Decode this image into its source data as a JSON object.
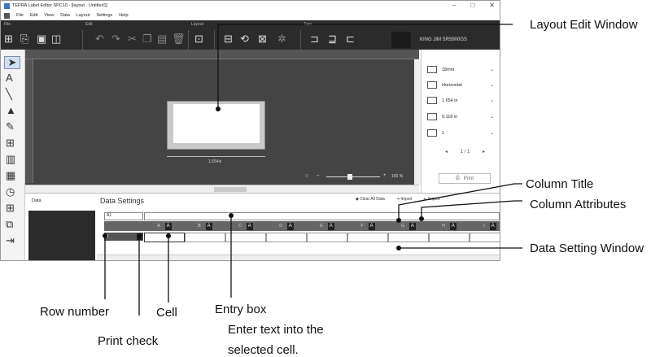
{
  "window": {
    "title": "TEPRA Label Editor SPC10 - [layout - Untitled1]",
    "controls": [
      "–",
      "□",
      "✕"
    ]
  },
  "menu": [
    "File",
    "Edit",
    "View",
    "Data",
    "Layout",
    "Settings",
    "Help"
  ],
  "ribbon": {
    "groups": [
      "File",
      "Edit",
      "Layout",
      "Tape"
    ]
  },
  "printer": {
    "name": "KING JIM SR5900GS"
  },
  "canvas": {
    "dimension": "1.654in",
    "zoom": "150 %"
  },
  "panel": {
    "rows": [
      {
        "icon": "tape-width-icon",
        "label": "18mm"
      },
      {
        "icon": "direction-icon",
        "label": "Horizontal"
      },
      {
        "icon": "length-icon",
        "label": "1.654 in"
      },
      {
        "icon": "margin-icon",
        "label": "0.118 in"
      },
      {
        "icon": "copies-icon",
        "label": "1"
      }
    ],
    "pages": "1 / 1",
    "print_label": "Print"
  },
  "data": {
    "pane_label": "Data",
    "settings_title": "Data Settings",
    "clear_all": "Clear All Data",
    "import": "Import",
    "export": "Export",
    "cell_ref": "A1",
    "columns": [
      "A",
      "B",
      "C",
      "D",
      "E",
      "F",
      "G",
      "H",
      "I"
    ],
    "attr_label": "A",
    "row_number": "1"
  },
  "annotations": {
    "layout_edit_window": "Layout Edit Window",
    "column_title": "Column Title",
    "column_attributes": "Column Attributes",
    "data_setting_window": "Data Setting Window",
    "row_number": "Row number",
    "cell": "Cell",
    "entry_box": "Entry box",
    "entry_desc1": "Enter text into the",
    "entry_desc2": "selected cell.",
    "print_check": "Print check"
  }
}
